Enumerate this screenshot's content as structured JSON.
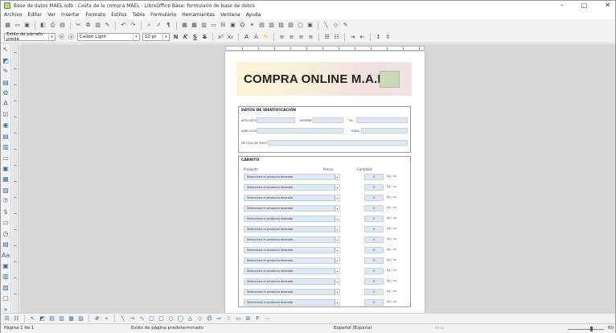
{
  "window": {
    "title": "Base de datos MAEL.odb : Cesta de la compra MAEL - LibreOffice Base: formulario de base de datos",
    "minimize": "–",
    "maximize": "□",
    "close": "✕"
  },
  "menu": [
    "Archivo",
    "Editar",
    "Ver",
    "Insertar",
    "Formato",
    "Estilos",
    "Tabla",
    "Formulario",
    "Herramientas",
    "Ventana",
    "Ayuda"
  ],
  "format_bar": {
    "paragraph_style": "Estilo de párrafo prede",
    "font_name": "Calibri Light",
    "font_size": "12 pt",
    "bold": "N",
    "italic": "K",
    "underline": "S",
    "strike": "S"
  },
  "form": {
    "banner_title": "COMPRA ONLINE M.A.E.L",
    "ident": {
      "heading": "DATOS DE IDENTIFICACIÓN",
      "apellidos": "APELLIDOS",
      "nombre": "NOMBRE",
      "tel": "TEL.",
      "direccion": "DIRECCIÓN",
      "email": "EMAIL",
      "metodo_pago": "MÉTODO DE PAGO"
    },
    "cart": {
      "heading": "CARRITO",
      "col_product": "Producto",
      "col_price": "Precio",
      "col_qty": "Cantidad",
      "rows": [
        {
          "product": "Seleccione el producto deseado",
          "qty": "0",
          "unit": "Kg / ud."
        },
        {
          "product": "Seleccione el producto deseado",
          "qty": "0",
          "unit": "Kg / ud."
        },
        {
          "product": "Seleccione el producto deseado",
          "qty": "0",
          "unit": "Kg / ud."
        },
        {
          "product": "Seleccione el producto deseado",
          "qty": "0",
          "unit": "Kg / ud."
        },
        {
          "product": "Seleccione el producto deseado",
          "qty": "0",
          "unit": "Kg / ud."
        },
        {
          "product": "Seleccione el producto deseado",
          "qty": "0",
          "unit": "Kg / ud."
        },
        {
          "product": "Seleccione el producto deseado",
          "qty": "0",
          "unit": "Kg / ud."
        },
        {
          "product": "Seleccione el producto deseado",
          "qty": "0",
          "unit": "Kg / ud."
        },
        {
          "product": "Seleccione el producto deseado",
          "qty": "0",
          "unit": "Kg / ud."
        },
        {
          "product": "Seleccione el producto deseado",
          "qty": "0",
          "unit": "Kg / ud."
        },
        {
          "product": "Seleccione el producto deseado",
          "qty": "0",
          "unit": "Kg / ud."
        },
        {
          "product": "Seleccione el producto deseado",
          "qty": "0",
          "unit": "Kg / ud."
        },
        {
          "product": "Seleccione el producto deseado",
          "qty": "0",
          "unit": "Kg / ud."
        }
      ]
    }
  },
  "status": {
    "page": "Página 1 de 1",
    "page_style": "Estilo de página predeterminado",
    "language": "Español (España)",
    "zoom": "60"
  }
}
